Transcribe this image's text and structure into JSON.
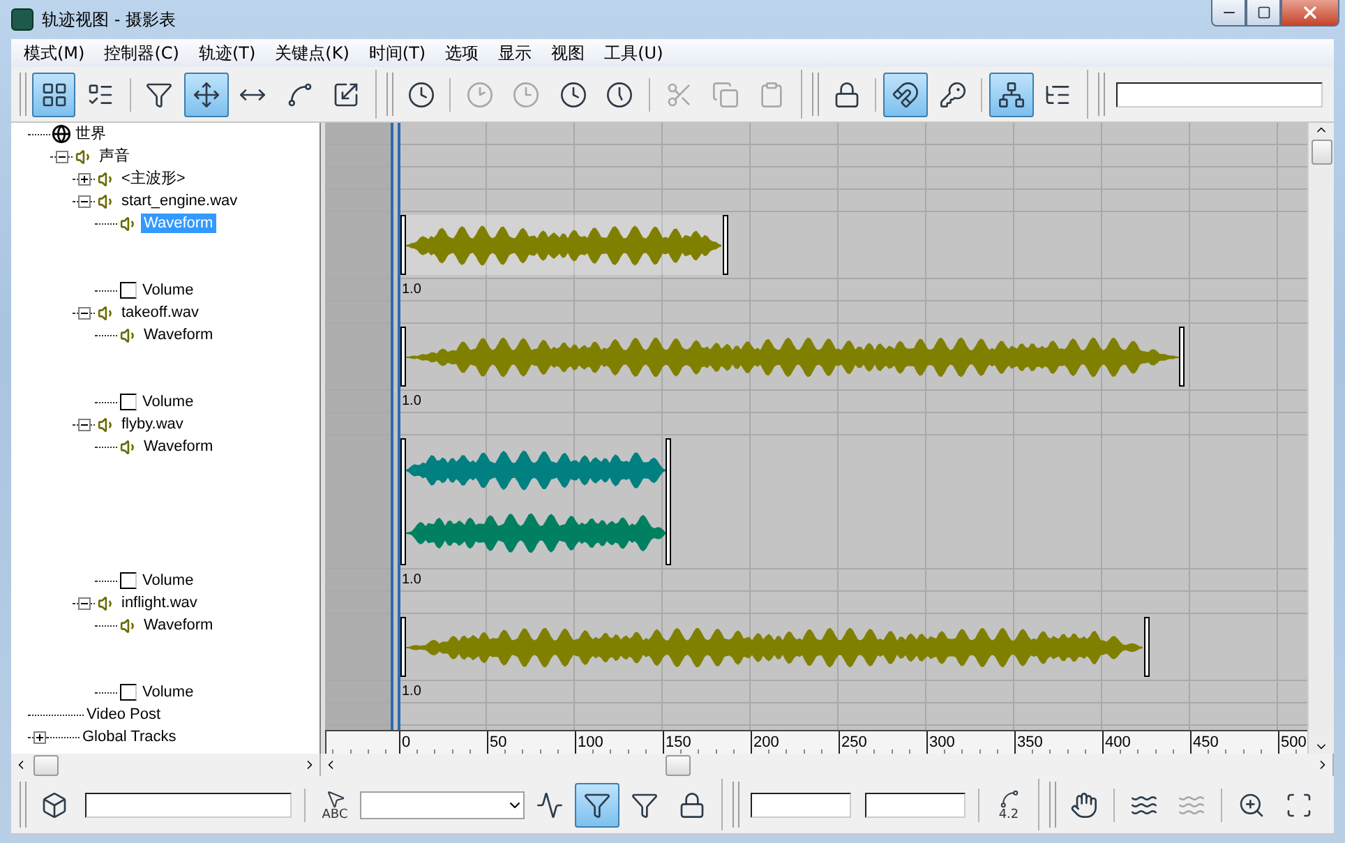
{
  "window": {
    "title": "轨迹视图 - 摄影表"
  },
  "menu": [
    "模式(M)",
    "控制器(C)",
    "轨迹(T)",
    "关键点(K)",
    "时间(T)",
    "选项",
    "显示",
    "视图",
    "工具(U)"
  ],
  "toolbar": [
    {
      "kind": "button",
      "selected": true
    },
    {
      "kind": "button",
      "selected": false
    },
    {
      "kind": "separator"
    },
    {
      "kind": "button",
      "selected": false
    },
    {
      "kind": "button",
      "selected": true
    },
    {
      "kind": "button",
      "selected": false
    },
    {
      "kind": "button",
      "selected": false
    },
    {
      "kind": "button",
      "selected": false
    },
    {
      "kind": "group"
    },
    {
      "kind": "button",
      "selected": false
    },
    {
      "kind": "separator"
    },
    {
      "kind": "button",
      "selected": false,
      "disabled": true
    },
    {
      "kind": "button",
      "selected": false,
      "disabled": true
    },
    {
      "kind": "button",
      "selected": false
    },
    {
      "kind": "button",
      "selected": false
    },
    {
      "kind": "separator"
    },
    {
      "kind": "button",
      "selected": false,
      "disabled": true
    },
    {
      "kind": "button",
      "selected": false,
      "disabled": true
    },
    {
      "kind": "button",
      "selected": false,
      "disabled": true
    },
    {
      "kind": "group"
    },
    {
      "kind": "button",
      "selected": false
    },
    {
      "kind": "separator"
    },
    {
      "kind": "button",
      "selected": true
    },
    {
      "kind": "button",
      "selected": false
    },
    {
      "kind": "separator"
    },
    {
      "kind": "button",
      "selected": true
    },
    {
      "kind": "button",
      "selected": false
    },
    {
      "kind": "group"
    },
    {
      "kind": "field"
    }
  ],
  "tree": [
    {
      "label": "世界",
      "kind": "world",
      "selected": false,
      "children": [
        {
          "label": "声音",
          "kind": "sound",
          "expanded": true,
          "selected": false,
          "children": [
            {
              "label": "<主波形>",
              "kind": "sound",
              "expanded": false,
              "selected": false
            },
            {
              "label": "start_engine.wav",
              "kind": "sound",
              "expanded": true,
              "selected": false,
              "children": [
                {
                  "label": "Waveform",
                  "kind": "waveform",
                  "selected": true,
                  "channels": [
                    {
                      "color": "#808000"
                    }
                  ]
                },
                {
                  "label": "Volume",
                  "kind": "volume",
                  "value": "1.0",
                  "selected": false
                }
              ]
            },
            {
              "label": "takeoff.wav",
              "kind": "sound",
              "expanded": true,
              "selected": false,
              "children": [
                {
                  "label": "Waveform",
                  "kind": "waveform",
                  "selected": false,
                  "channels": [
                    {
                      "color": "#808000"
                    }
                  ]
                },
                {
                  "label": "Volume",
                  "kind": "volume",
                  "value": "1.0",
                  "selected": false
                }
              ]
            },
            {
              "label": "flyby.wav",
              "kind": "sound",
              "expanded": true,
              "selected": false,
              "children": [
                {
                  "label": "Waveform",
                  "kind": "waveform",
                  "selected": false,
                  "channels": [
                    {
                      "color": "#008080"
                    },
                    {
                      "color": "#008060"
                    }
                  ]
                },
                {
                  "label": "Volume",
                  "kind": "volume",
                  "value": "1.0",
                  "selected": false
                }
              ]
            },
            {
              "label": "inflight.wav",
              "kind": "sound",
              "expanded": true,
              "selected": false,
              "children": [
                {
                  "label": "Waveform",
                  "kind": "waveform",
                  "selected": false,
                  "channels": [
                    {
                      "color": "#808000"
                    }
                  ]
                },
                {
                  "label": "Volume",
                  "kind": "volume",
                  "value": "1.0",
                  "selected": false
                }
              ]
            }
          ]
        }
      ]
    },
    {
      "label": "Video Post",
      "kind": "plain",
      "selected": false
    },
    {
      "label": "Global Tracks",
      "kind": "plain",
      "expanded": false,
      "selected": false
    }
  ],
  "ruler": {
    "labels": [
      "0",
      "50",
      "100",
      "150",
      "200",
      "250",
      "300",
      "350",
      "400",
      "450",
      "500"
    ]
  },
  "bottom_toolbar": [
    {
      "kind": "button",
      "selected": false
    },
    {
      "kind": "field"
    },
    {
      "kind": "separator"
    },
    {
      "kind": "button",
      "selected": false,
      "text": "ABC"
    },
    {
      "kind": "dropdown"
    },
    {
      "kind": "button",
      "selected": false
    },
    {
      "kind": "button",
      "selected": true
    },
    {
      "kind": "button",
      "selected": false
    },
    {
      "kind": "button",
      "selected": false
    },
    {
      "kind": "group"
    },
    {
      "kind": "field"
    },
    {
      "kind": "field"
    },
    {
      "kind": "separator"
    },
    {
      "kind": "button",
      "selected": false,
      "text": "4.2"
    },
    {
      "kind": "group"
    },
    {
      "kind": "button",
      "selected": false
    },
    {
      "kind": "separator"
    },
    {
      "kind": "button",
      "selected": false
    },
    {
      "kind": "button",
      "selected": false,
      "disabled": true
    },
    {
      "kind": "separator"
    },
    {
      "kind": "button",
      "selected": false
    },
    {
      "kind": "button",
      "selected": false
    }
  ]
}
